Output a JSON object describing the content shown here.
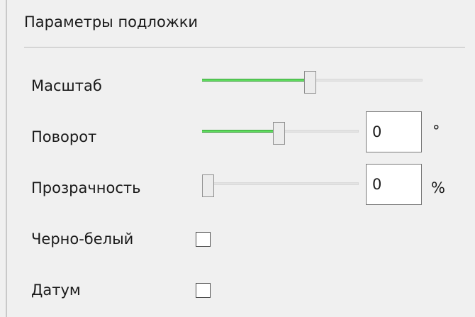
{
  "group": {
    "title": "Параметры подложки"
  },
  "scale": {
    "label": "Масштаб",
    "fraction": 0.49
  },
  "rotation": {
    "label": "Поворот",
    "fraction": 0.49,
    "value": "0",
    "unit": "°"
  },
  "opacity": {
    "label": "Прозрачность",
    "fraction": 0.0,
    "value": "0",
    "unit": "%"
  },
  "grayscale": {
    "label": "Черно-белый",
    "checked": false
  },
  "datum": {
    "label": "Датум",
    "checked": false
  },
  "colors": {
    "slider_fill": "#5fdc5f",
    "panel_background": "#f0f0f0"
  }
}
